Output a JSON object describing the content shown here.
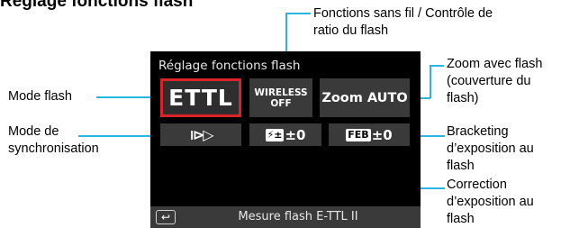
{
  "heading": "Réglage fonctions flash",
  "annotations": {
    "top_line1": "Fonctions sans fil / Contrôle de",
    "top_line2": "ratio du flash",
    "mode_flash": "Mode flash",
    "sync_line1": "Mode de",
    "sync_line2": "synchronisation",
    "zoom_line1": "Zoom avec flash",
    "zoom_line2": "(couverture du",
    "zoom_line3": "flash)",
    "feb_line1": "Bracketing",
    "feb_line2": "d’exposition au",
    "feb_line3": "flash",
    "corr_line1": "Correction",
    "corr_line2": "d’exposition au",
    "corr_line3": "flash"
  },
  "screen": {
    "title": "Réglage fonctions flash",
    "flash_mode": "ETTL",
    "wireless_line1": "WIRELESS",
    "wireless_line2": "OFF",
    "zoom": "Zoom AUTO",
    "sync_icon": "⧐▷",
    "fec_icon": "⚡±",
    "fec_value": "±0",
    "feb_icon": "FEB",
    "feb_value": "±0",
    "back_icon": "↩",
    "bottom_label": "Mesure flash E-TTL II",
    "accent_color": "#d8242b",
    "line_color": "#29b6e3"
  }
}
